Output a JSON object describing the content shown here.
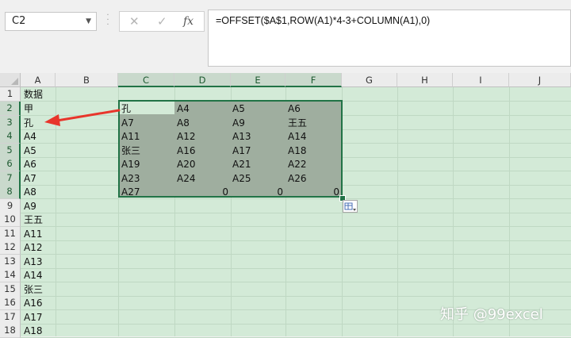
{
  "formula_bar": {
    "name_box": "C2",
    "cancel_icon": "✕",
    "enter_icon": "✓",
    "fx_label": "fx",
    "formula": "=OFFSET($A$1,ROW(A1)*4-3+COLUMN(A1),0)"
  },
  "columns": [
    "A",
    "B",
    "C",
    "D",
    "E",
    "F",
    "G",
    "H",
    "I",
    "J"
  ],
  "rows": [
    "1",
    "2",
    "3",
    "4",
    "5",
    "6",
    "7",
    "8",
    "9",
    "10",
    "11",
    "12",
    "13",
    "14",
    "15",
    "16",
    "17",
    "18"
  ],
  "col_a": [
    "数据",
    "甲",
    "孔",
    "A4",
    "A5",
    "A6",
    "A7",
    "A8",
    "A9",
    "王五",
    "A11",
    "A12",
    "A13",
    "A14",
    "张三",
    "A16",
    "A17",
    "A18"
  ],
  "cf_grid": [
    [
      "孔",
      "A4",
      "A5",
      "A6"
    ],
    [
      "A7",
      "A8",
      "A9",
      "王五"
    ],
    [
      "A11",
      "A12",
      "A13",
      "A14"
    ],
    [
      "张三",
      "A16",
      "A17",
      "A18"
    ],
    [
      "A19",
      "A20",
      "A21",
      "A22"
    ],
    [
      "A23",
      "A24",
      "A25",
      "A26"
    ],
    [
      "A27",
      "0",
      "0",
      "0"
    ]
  ],
  "watermark": "知乎 @99excel",
  "colors": {
    "accent": "#217346",
    "arrow": "#e8352b",
    "grid_bg": "#d3ead7",
    "selection_bg": "#9fae9f"
  }
}
